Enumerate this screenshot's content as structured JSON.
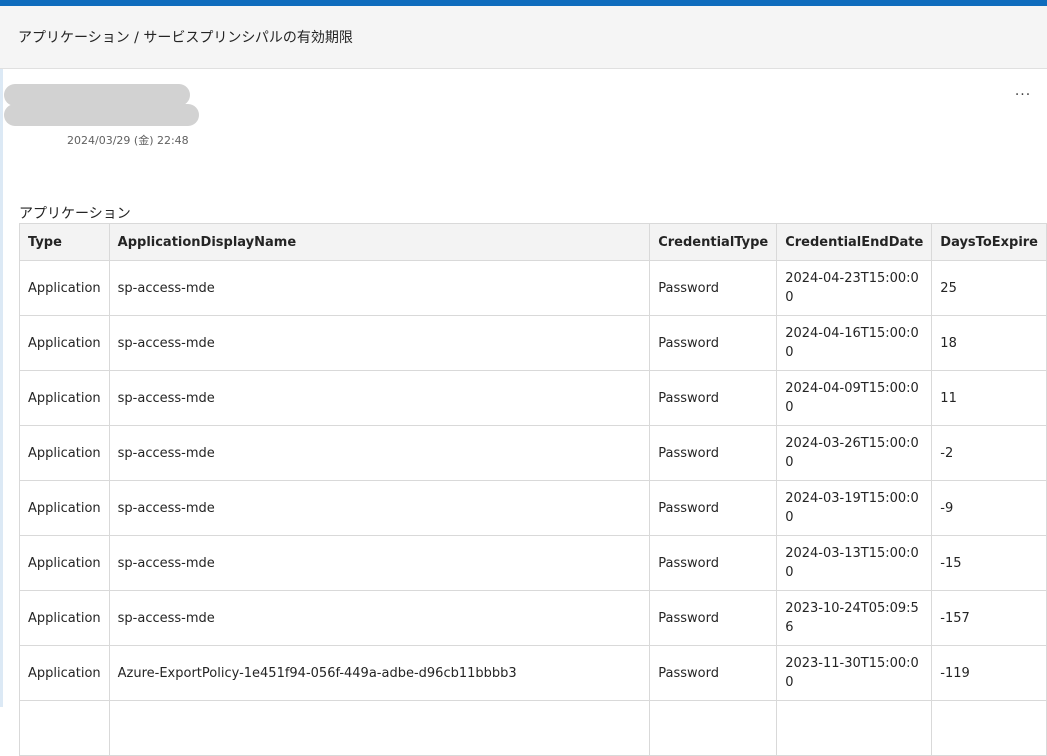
{
  "header": {
    "title": "アプリケーション / サービスプリンシパルの有効期限"
  },
  "message": {
    "timestamp": "2024/03/29 (金) 22:48",
    "more_label": "···"
  },
  "section": {
    "title": "アプリケーション"
  },
  "table": {
    "columns": [
      "Type",
      "ApplicationDisplayName",
      "CredentialType",
      "CredentialEndDate",
      "DaysToExpire"
    ],
    "rows": [
      {
        "type": "Application",
        "name": "sp-access-mde",
        "ctype": "Password",
        "end": "2024-04-23T15:00:00",
        "days": "25"
      },
      {
        "type": "Application",
        "name": "sp-access-mde",
        "ctype": "Password",
        "end": "2024-04-16T15:00:00",
        "days": "18"
      },
      {
        "type": "Application",
        "name": "sp-access-mde",
        "ctype": "Password",
        "end": "2024-04-09T15:00:00",
        "days": "11"
      },
      {
        "type": "Application",
        "name": "sp-access-mde",
        "ctype": "Password",
        "end": "2024-03-26T15:00:00",
        "days": "-2"
      },
      {
        "type": "Application",
        "name": "sp-access-mde",
        "ctype": "Password",
        "end": "2024-03-19T15:00:00",
        "days": "-9"
      },
      {
        "type": "Application",
        "name": "sp-access-mde",
        "ctype": "Password",
        "end": "2024-03-13T15:00:00",
        "days": "-15"
      },
      {
        "type": "Application",
        "name": "sp-access-mde",
        "ctype": "Password",
        "end": "2023-10-24T05:09:56",
        "days": "-157"
      },
      {
        "type": "Application",
        "name": "Azure-ExportPolicy-1e451f94-056f-449a-adbe-d96cb11bbbb3",
        "ctype": "Password",
        "end": "2023-11-30T15:00:00",
        "days": "-119"
      },
      {
        "type": "",
        "name": "",
        "ctype": "",
        "end": "",
        "days": ""
      }
    ]
  },
  "colors": {
    "accent": "#0f6cbd",
    "header_bg": "#f5f5f5",
    "table_header_bg": "#f3f3f3",
    "border": "#d9d9d9"
  }
}
